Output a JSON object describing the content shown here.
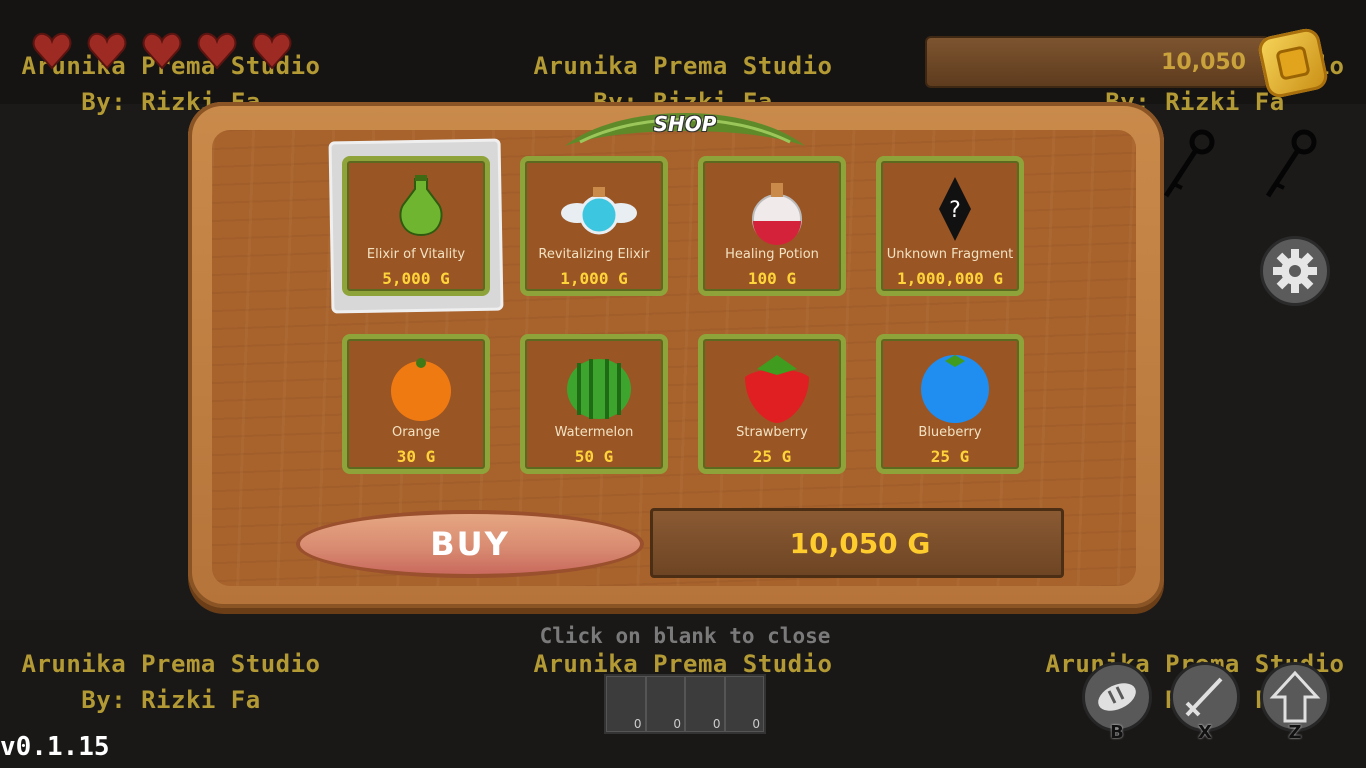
{
  "watermark": {
    "studio": "Arunika Prema Studio",
    "author": "By: Rizki Fa"
  },
  "hud": {
    "hearts": 5,
    "coins": "10,050",
    "version": "v0.1.15"
  },
  "shop": {
    "title": "SHOP",
    "selected_index": 0,
    "items": [
      {
        "name": "Elixir of Vitality",
        "price": "5,000 G",
        "icon": "green-elixir-icon"
      },
      {
        "name": "Revitalizing Elixir",
        "price": "1,000 G",
        "icon": "winged-elixir-icon"
      },
      {
        "name": "Healing Potion",
        "price": "100 G",
        "icon": "red-potion-icon"
      },
      {
        "name": "Unknown Fragment",
        "price": "1,000,000 G",
        "icon": "mystery-fragment-icon"
      },
      {
        "name": "Orange",
        "price": "30 G",
        "icon": "orange-icon"
      },
      {
        "name": "Watermelon",
        "price": "50 G",
        "icon": "watermelon-icon"
      },
      {
        "name": "Strawberry",
        "price": "25 G",
        "icon": "strawberry-icon"
      },
      {
        "name": "Blueberry",
        "price": "25 G",
        "icon": "blueberry-icon"
      }
    ],
    "buy_label": "BUY",
    "total": "10,050 G",
    "close_hint": "Click on blank to close"
  },
  "inventory": {
    "counts": [
      "0",
      "0",
      "0",
      "0"
    ]
  },
  "actions": [
    {
      "key": "B",
      "icon": "bread-icon"
    },
    {
      "key": "X",
      "icon": "sword-icon"
    },
    {
      "key": "Z",
      "icon": "up-arrow-icon"
    }
  ],
  "colors": {
    "price": "#ffd43a",
    "slot_border": "#8ea43a",
    "wood": "#a8622c"
  }
}
